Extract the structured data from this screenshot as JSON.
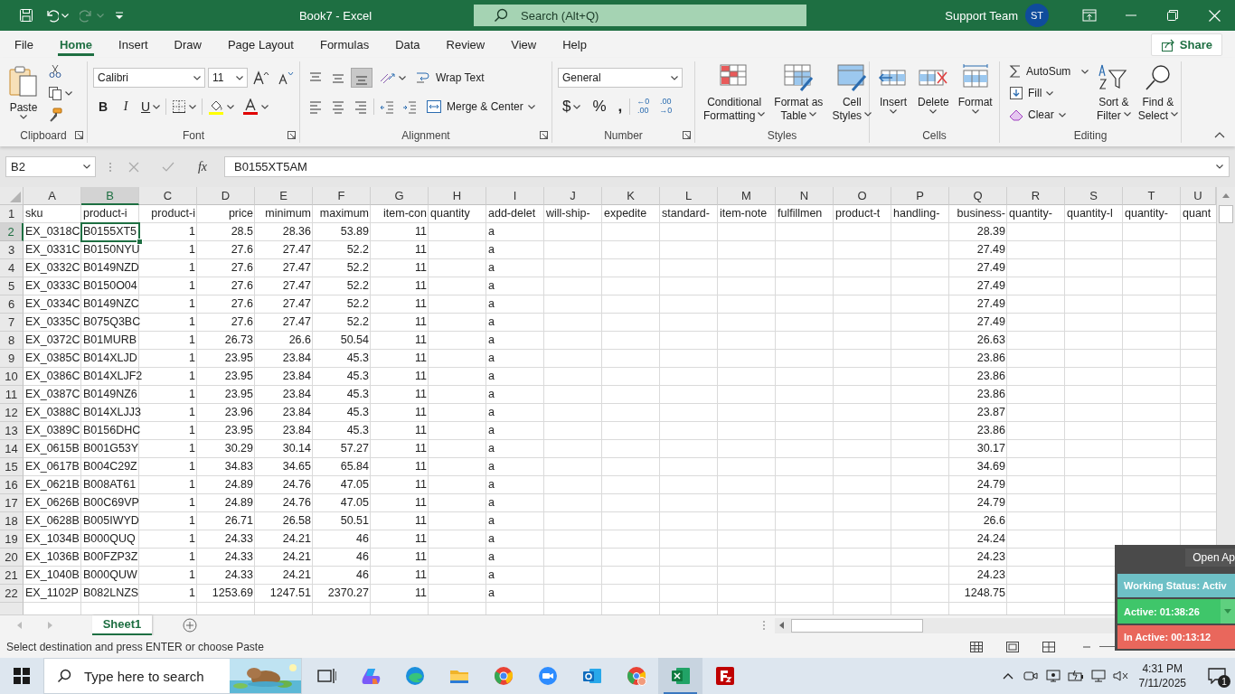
{
  "title_bar": {
    "document_title": "Book7  -  Excel",
    "search_placeholder": "Search (Alt+Q)",
    "user_name": "Support Team",
    "user_initials": "ST"
  },
  "menu_tabs": [
    {
      "label": "File",
      "selected": false
    },
    {
      "label": "Home",
      "selected": true
    },
    {
      "label": "Insert",
      "selected": false
    },
    {
      "label": "Draw",
      "selected": false
    },
    {
      "label": "Page Layout",
      "selected": false
    },
    {
      "label": "Formulas",
      "selected": false
    },
    {
      "label": "Data",
      "selected": false
    },
    {
      "label": "Review",
      "selected": false
    },
    {
      "label": "View",
      "selected": false
    },
    {
      "label": "Help",
      "selected": false
    }
  ],
  "share_button": "Share",
  "ribbon": {
    "groups": [
      {
        "kind": "clipboard",
        "label": "Clipboard",
        "paste": "Paste"
      },
      {
        "kind": "font",
        "label": "Font",
        "font_name": "Calibri",
        "font_size": "11",
        "bold": "B",
        "italic": "I",
        "underline": "U"
      },
      {
        "kind": "alignment",
        "label": "Alignment",
        "vertical_align": [
          {
            "selected": false
          },
          {
            "selected": false
          },
          {
            "selected": true
          }
        ],
        "wrap_text": "Wrap Text",
        "merge": "Merge & Center"
      },
      {
        "kind": "number",
        "label": "Number",
        "format": "General",
        "currency": "$",
        "percent": "%",
        "comma": ",",
        "increase_decimal": [
          "←0",
          ".00"
        ],
        "decrease_decimal": [
          ".00",
          "→0"
        ]
      },
      {
        "kind": "styles",
        "label": "Styles",
        "buttons": [
          [
            "Conditional",
            "Formatting"
          ],
          [
            "Format as",
            "Table"
          ],
          [
            "Cell",
            "Styles"
          ]
        ]
      },
      {
        "kind": "cells",
        "label": "Cells",
        "buttons": [
          "Insert",
          "Delete",
          "Format"
        ]
      },
      {
        "kind": "editing",
        "label": "Editing",
        "autosum": "AutoSum",
        "fill": "Fill",
        "clear": "Clear",
        "buttons": [
          [
            "Sort &",
            "Filter"
          ],
          [
            "Find &",
            "Select"
          ]
        ]
      }
    ]
  },
  "formula_bar": {
    "name_box": "B2",
    "function_label": "fx",
    "formula": "B0155XT5AM"
  },
  "sheet": {
    "header_row_number": "1",
    "columns": [
      {
        "letter": "A",
        "header": "sku",
        "kind": "text",
        "selected": false
      },
      {
        "letter": "B",
        "header": "product-i",
        "kind": "text",
        "selected": true
      },
      {
        "letter": "C",
        "header": "product-i",
        "kind": "number",
        "selected": false
      },
      {
        "letter": "D",
        "header": "price",
        "kind": "number",
        "selected": false
      },
      {
        "letter": "E",
        "header": "minimum",
        "kind": "number",
        "selected": false
      },
      {
        "letter": "F",
        "header": "maximum",
        "kind": "number",
        "selected": false
      },
      {
        "letter": "G",
        "header": "item-con",
        "kind": "number",
        "selected": false
      },
      {
        "letter": "H",
        "header": "quantity",
        "kind": "text",
        "selected": false
      },
      {
        "letter": "I",
        "header": "add-delet",
        "kind": "text",
        "selected": false
      },
      {
        "letter": "J",
        "header": "will-ship-",
        "kind": "text",
        "selected": false
      },
      {
        "letter": "K",
        "header": "expedite",
        "kind": "text",
        "selected": false
      },
      {
        "letter": "L",
        "header": "standard-",
        "kind": "text",
        "selected": false
      },
      {
        "letter": "M",
        "header": "item-note",
        "kind": "text",
        "selected": false
      },
      {
        "letter": "N",
        "header": "fulfillmen",
        "kind": "text",
        "selected": false
      },
      {
        "letter": "O",
        "header": "product-t",
        "kind": "text",
        "selected": false
      },
      {
        "letter": "P",
        "header": "handling-",
        "kind": "text",
        "selected": false
      },
      {
        "letter": "Q",
        "header": "business-",
        "kind": "number",
        "selected": false
      },
      {
        "letter": "R",
        "header": "quantity-",
        "kind": "text",
        "selected": false
      },
      {
        "letter": "S",
        "header": "quantity-l",
        "kind": "text",
        "selected": false
      },
      {
        "letter": "T",
        "header": "quantity-",
        "kind": "text",
        "selected": false
      },
      {
        "letter": "U",
        "header": "quant",
        "kind": "text",
        "selected": false
      }
    ],
    "rows": [
      {
        "number": "2",
        "selected": true,
        "cells": {
          "A": "EX_0318C",
          "B": "B0155XT5",
          "C": "1",
          "D": "28.5",
          "E": "28.36",
          "F": "53.89",
          "G": "11",
          "I": "a",
          "Q": "28.39"
        }
      },
      {
        "number": "3",
        "selected": false,
        "cells": {
          "A": "EX_0331C",
          "B": "B0150NYU",
          "C": "1",
          "D": "27.6",
          "E": "27.47",
          "F": "52.2",
          "G": "11",
          "I": "a",
          "Q": "27.49"
        }
      },
      {
        "number": "4",
        "selected": false,
        "cells": {
          "A": "EX_0332C",
          "B": "B0149NZD",
          "C": "1",
          "D": "27.6",
          "E": "27.47",
          "F": "52.2",
          "G": "11",
          "I": "a",
          "Q": "27.49"
        }
      },
      {
        "number": "5",
        "selected": false,
        "cells": {
          "A": "EX_0333C",
          "B": "B0150O04",
          "C": "1",
          "D": "27.6",
          "E": "27.47",
          "F": "52.2",
          "G": "11",
          "I": "a",
          "Q": "27.49"
        }
      },
      {
        "number": "6",
        "selected": false,
        "cells": {
          "A": "EX_0334C",
          "B": "B0149NZC",
          "C": "1",
          "D": "27.6",
          "E": "27.47",
          "F": "52.2",
          "G": "11",
          "I": "a",
          "Q": "27.49"
        }
      },
      {
        "number": "7",
        "selected": false,
        "cells": {
          "A": "EX_0335C",
          "B": "B075Q3BC",
          "C": "1",
          "D": "27.6",
          "E": "27.47",
          "F": "52.2",
          "G": "11",
          "I": "a",
          "Q": "27.49"
        }
      },
      {
        "number": "8",
        "selected": false,
        "cells": {
          "A": "EX_0372C",
          "B": "B01MURB",
          "C": "1",
          "D": "26.73",
          "E": "26.6",
          "F": "50.54",
          "G": "11",
          "I": "a",
          "Q": "26.63"
        }
      },
      {
        "number": "9",
        "selected": false,
        "cells": {
          "A": "EX_0385C",
          "B": "B014XLJD",
          "C": "1",
          "D": "23.95",
          "E": "23.84",
          "F": "45.3",
          "G": "11",
          "I": "a",
          "Q": "23.86"
        }
      },
      {
        "number": "10",
        "selected": false,
        "cells": {
          "A": "EX_0386C",
          "B": "B014XLJF2",
          "C": "1",
          "D": "23.95",
          "E": "23.84",
          "F": "45.3",
          "G": "11",
          "I": "a",
          "Q": "23.86"
        }
      },
      {
        "number": "11",
        "selected": false,
        "cells": {
          "A": "EX_0387C",
          "B": "B0149NZ6",
          "C": "1",
          "D": "23.95",
          "E": "23.84",
          "F": "45.3",
          "G": "11",
          "I": "a",
          "Q": "23.86"
        }
      },
      {
        "number": "12",
        "selected": false,
        "cells": {
          "A": "EX_0388C",
          "B": "B014XLJJ3",
          "C": "1",
          "D": "23.96",
          "E": "23.84",
          "F": "45.3",
          "G": "11",
          "I": "a",
          "Q": "23.87"
        }
      },
      {
        "number": "13",
        "selected": false,
        "cells": {
          "A": "EX_0389C",
          "B": "B0156DHC",
          "C": "1",
          "D": "23.95",
          "E": "23.84",
          "F": "45.3",
          "G": "11",
          "I": "a",
          "Q": "23.86"
        }
      },
      {
        "number": "14",
        "selected": false,
        "cells": {
          "A": "EX_0615B",
          "B": "B001G53Y",
          "C": "1",
          "D": "30.29",
          "E": "30.14",
          "F": "57.27",
          "G": "11",
          "I": "a",
          "Q": "30.17"
        }
      },
      {
        "number": "15",
        "selected": false,
        "cells": {
          "A": "EX_0617B",
          "B": "B004C29Z",
          "C": "1",
          "D": "34.83",
          "E": "34.65",
          "F": "65.84",
          "G": "11",
          "I": "a",
          "Q": "34.69"
        }
      },
      {
        "number": "16",
        "selected": false,
        "cells": {
          "A": "EX_0621B",
          "B": "B008AT61",
          "C": "1",
          "D": "24.89",
          "E": "24.76",
          "F": "47.05",
          "G": "11",
          "I": "a",
          "Q": "24.79"
        }
      },
      {
        "number": "17",
        "selected": false,
        "cells": {
          "A": "EX_0626B",
          "B": "B00C69VP",
          "C": "1",
          "D": "24.89",
          "E": "24.76",
          "F": "47.05",
          "G": "11",
          "I": "a",
          "Q": "24.79"
        }
      },
      {
        "number": "18",
        "selected": false,
        "cells": {
          "A": "EX_0628B",
          "B": "B005IWYD",
          "C": "1",
          "D": "26.71",
          "E": "26.58",
          "F": "50.51",
          "G": "11",
          "I": "a",
          "Q": "26.6"
        }
      },
      {
        "number": "19",
        "selected": false,
        "cells": {
          "A": "EX_1034B",
          "B": "B000QUQ",
          "C": "1",
          "D": "24.33",
          "E": "24.21",
          "F": "46",
          "G": "11",
          "I": "a",
          "Q": "24.24"
        }
      },
      {
        "number": "20",
        "selected": false,
        "cells": {
          "A": "EX_1036B",
          "B": "B00FZP3Z",
          "C": "1",
          "D": "24.33",
          "E": "24.21",
          "F": "46",
          "G": "11",
          "I": "a",
          "Q": "24.23"
        }
      },
      {
        "number": "21",
        "selected": false,
        "cells": {
          "A": "EX_1040B",
          "B": "B000QUW",
          "C": "1",
          "D": "24.33",
          "E": "24.21",
          "F": "46",
          "G": "11",
          "I": "a",
          "Q": "24.23"
        }
      },
      {
        "number": "22",
        "selected": false,
        "cells": {
          "A": "EX_1102P",
          "B": "B082LNZS",
          "C": "1",
          "D": "1253.69",
          "E": "1247.51",
          "F": "2370.27",
          "G": "11",
          "I": "a",
          "Q": "1248.75"
        }
      }
    ]
  },
  "sheet_tabs": [
    {
      "label": "Sheet1",
      "selected": true
    }
  ],
  "status_bar": {
    "message": "Select destination and press ENTER or choose Paste"
  },
  "time_tracker": {
    "open_button": "Open Ap",
    "working_status": "Working Status: Activ",
    "active_time": "Active: 01:38:26",
    "inactive_time": "In Active: 00:13:12"
  },
  "taskbar": {
    "search_placeholder": "Type here to search",
    "apps": [
      {
        "kind": "task-view",
        "selected": false
      },
      {
        "kind": "copilot",
        "selected": false
      },
      {
        "kind": "edge",
        "selected": false
      },
      {
        "kind": "files",
        "selected": false
      },
      {
        "kind": "chrome",
        "selected": false
      },
      {
        "kind": "zoom",
        "selected": false
      },
      {
        "kind": "outlook",
        "selected": false
      },
      {
        "kind": "chrome-profile",
        "selected": false
      },
      {
        "kind": "excel",
        "selected": true
      },
      {
        "kind": "filezilla",
        "selected": false
      }
    ],
    "time": "4:31 PM",
    "date": "7/11/2025",
    "notification_count": "1"
  }
}
